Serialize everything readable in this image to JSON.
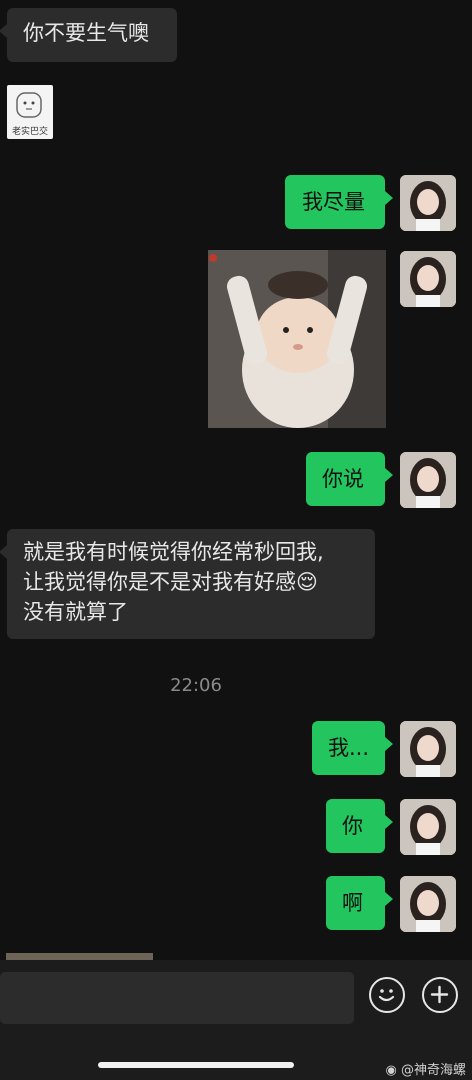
{
  "messages": {
    "m1": "你不要生气噢",
    "sticker_label": "老实巴交",
    "m2": "我尽量",
    "m3": "你说",
    "m4_line1": "就是我有时候觉得你经常秒回我,",
    "m4_line2": "让我觉得你是不是对我有好感😌",
    "m4_line3": "没有就算了",
    "time": "22:06",
    "m5": "我...",
    "m6": "你",
    "m7": "啊"
  },
  "footer": {
    "watermark": "@神奇海螺"
  },
  "icons": {
    "emoji_button": "smiley-icon",
    "plus_button": "plus-icon",
    "watermark_logo": "weibo-icon"
  },
  "colors": {
    "background": "#111111",
    "incoming_bubble": "#2c2c2c",
    "outgoing_bubble": "#22c55e"
  }
}
